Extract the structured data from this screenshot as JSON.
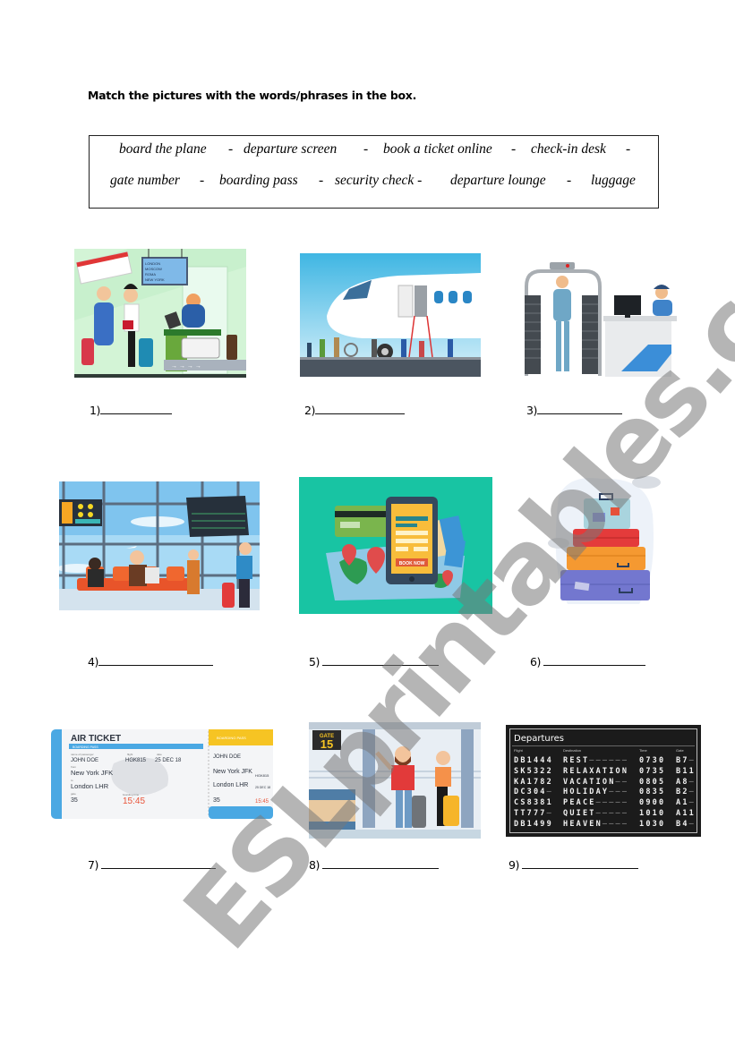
{
  "instruction": "Match the pictures with the words/phrases in the box.",
  "word_box": {
    "row1": [
      "board the plane",
      "-",
      "departure screen",
      "-",
      "book a ticket online",
      "-",
      "check-in desk",
      "-"
    ],
    "row2": [
      "gate number",
      "-",
      "boarding pass",
      "-",
      "security check -",
      "departure lounge",
      "-",
      "luggage"
    ]
  },
  "pictures": [
    {
      "number": "1)",
      "depicts": "check-in-desk-illustration",
      "board_rows": [
        "LONDON",
        "MOSCOW",
        "ROMA",
        "NEW YORK"
      ]
    },
    {
      "number": "2)",
      "depicts": "boarding-plane-illustration"
    },
    {
      "number": "3)",
      "depicts": "security-check-illustration"
    },
    {
      "number": "4)",
      "depicts": "departure-lounge-illustration"
    },
    {
      "number": "5)",
      "depicts": "book-ticket-online-illustration",
      "phone_button": "BOOK NOW"
    },
    {
      "number": "6)",
      "depicts": "luggage-illustration"
    },
    {
      "number": "7)",
      "depicts": "boarding-pass-illustration"
    },
    {
      "number": "8)",
      "depicts": "gate-number-illustration"
    },
    {
      "number": "9)",
      "depicts": "departure-screen-illustration"
    }
  ],
  "answer_blank": "________________",
  "ticket": {
    "title": "AIR TICKET",
    "subtitle": "BOARDING PASS",
    "stub_title": "BOARDING PASS",
    "passenger_label": "name of passenger",
    "passenger": "JOHN DOE",
    "flight_label": "flight",
    "flight": "HGK815",
    "date_label": "date",
    "date": "25 DEC 18",
    "from_label": "from",
    "from": "New York JFK",
    "to_label": "to",
    "to": "London LHR",
    "gate_label": "gate",
    "gate": "35",
    "boarding_label": "boarding time",
    "boarding_time": "15:45"
  },
  "gate_sign": {
    "label": "GATE",
    "number": "15"
  },
  "departures_board": {
    "title": "Departures",
    "headers": [
      "Flight",
      "Destination",
      "Time",
      "Gate"
    ],
    "rows": [
      [
        "DB1444",
        "REST",
        "0730",
        "B7"
      ],
      [
        "SK5322",
        "RELAXATION",
        "0735",
        "B11"
      ],
      [
        "KA1782",
        "VACATION",
        "0805",
        "A8"
      ],
      [
        "DC304",
        "HOLIDAY",
        "0835",
        "B2"
      ],
      [
        "CS8381",
        "PEACE",
        "0900",
        "A1"
      ],
      [
        "TT777",
        "QUIET",
        "1010",
        "A11"
      ],
      [
        "DB1499",
        "HEAVEN",
        "1030",
        "B4"
      ]
    ]
  },
  "watermark": "ESLprintables.com"
}
